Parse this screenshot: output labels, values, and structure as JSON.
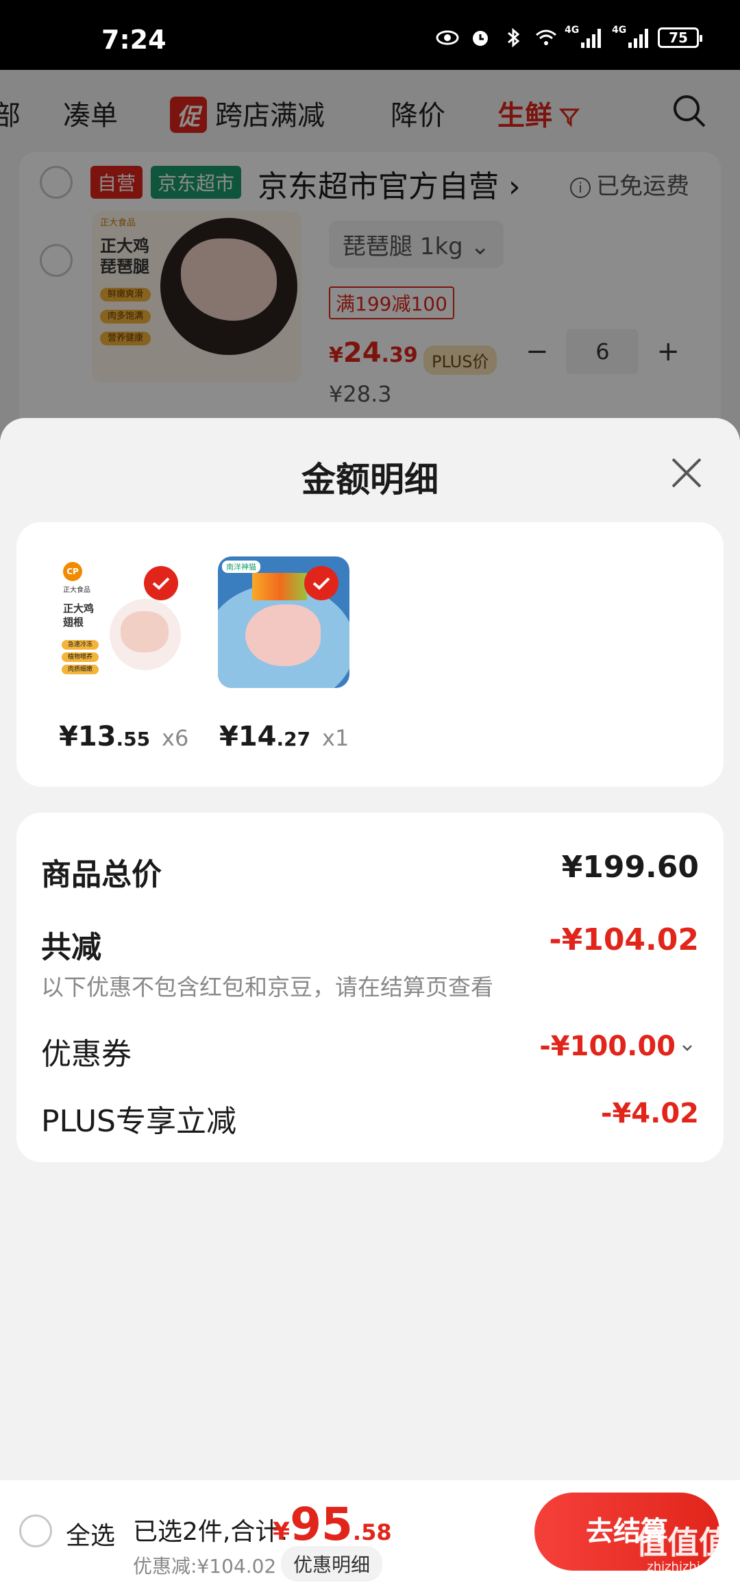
{
  "status_bar": {
    "time": "7:24",
    "battery": "75",
    "network_tag_1": "4G",
    "network_tag_2": "4G"
  },
  "filter_tabs": {
    "partial_left": "部",
    "items": [
      "凑单",
      "跨店满减",
      "降价",
      "生鲜"
    ],
    "promo_badge": "促",
    "active": "生鲜"
  },
  "store": {
    "tag_self": "自营",
    "tag_supermarket": "京东超市",
    "name": "京东超市官方自营",
    "name_arrow": "›",
    "shipping": "已免运费",
    "info_symbol": "i"
  },
  "cart_item": {
    "image_title_line1": "正大鸡",
    "image_title_line2": "琵琶腿",
    "image_chips": [
      "鲜嫩爽滑",
      "肉多饱满",
      "营养健康"
    ],
    "image_brand": "正大食品",
    "spec": "琵琶腿 1kg",
    "spec_arrow": "⌄",
    "promo": "满199减100",
    "price_currency": "¥",
    "price_int": "24",
    "price_dec": ".39",
    "plus_tag": "PLUS价",
    "original_price": "¥28.3",
    "minus": "−",
    "quantity": "6",
    "plus": "+"
  },
  "sheet": {
    "title": "金额明细",
    "items": [
      {
        "price_int": "¥13",
        "price_dec": ".55",
        "qty": "x6",
        "image_brand": "CP",
        "image_brand_sub": "正大食品",
        "image_title": "正大鸡翅根",
        "image_chips": [
          "急速冷冻",
          "植物喂养",
          "肉质细嫩"
        ]
      },
      {
        "price_int": "¥14",
        "price_dec": ".27",
        "qty": "x1",
        "image_brand": "南洋神猫"
      }
    ],
    "summary": {
      "total_label": "商品总价",
      "total_value": "¥199.60",
      "reduction_label": "共减",
      "reduction_value": "-¥104.02",
      "note": "以下优惠不包含红包和京豆，请在结算页查看",
      "coupon_label": "优惠券",
      "coupon_value": "-¥100.00",
      "plus_label": "PLUS专享立减",
      "plus_value": "-¥4.02"
    }
  },
  "bottom_bar": {
    "select_all": "全选",
    "selected_text": "已选2件,合计:",
    "total_currency": "¥",
    "total_int": "95",
    "total_dec": ".58",
    "discount_text": "优惠减:¥104.02",
    "discount_detail": "优惠明细",
    "checkout": "去结算"
  },
  "watermark": {
    "text": "值值值",
    "sub": "zhizhizhi.com"
  },
  "colors": {
    "accent": "#e1251b",
    "supermarket_green": "#1a9b6c",
    "plus_gold": "#f7e2b6",
    "background": "#f2f2f2"
  }
}
